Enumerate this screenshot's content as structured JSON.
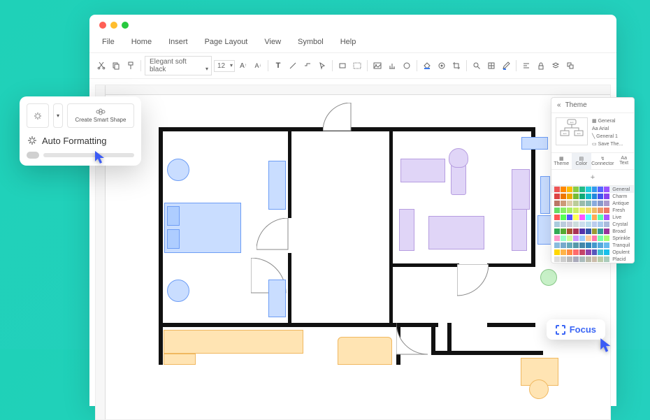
{
  "menu": {
    "file": "File",
    "home": "Home",
    "insert": "Insert",
    "page_layout": "Page Layout",
    "view": "View",
    "symbol": "Symbol",
    "help": "Help"
  },
  "toolbar": {
    "font": "Elegant soft black",
    "size": "12"
  },
  "popover": {
    "create_smart": "Create Smart Shape",
    "auto_fmt": "Auto Formatting"
  },
  "theme": {
    "title": "Theme",
    "opts": {
      "general": "General",
      "arial": "Arial",
      "general1": "General 1",
      "save": "Save The..."
    },
    "tabs": {
      "theme": "Theme",
      "color": "Color",
      "connector": "Connector",
      "text": "Text"
    },
    "plus": "+",
    "palette_names": [
      "General",
      "Charm",
      "Antique",
      "Fresh",
      "Live",
      "Crystal",
      "Broad",
      "Sprinkle",
      "Tranquil",
      "Opulent",
      "Placid"
    ]
  },
  "focus": {
    "label": "Focus"
  },
  "colors": {
    "rows": [
      [
        "#e55",
        "#f80",
        "#fb0",
        "#8c4",
        "#2b8",
        "#2cd",
        "#39e",
        "#56f",
        "#95f",
        "#d5d"
      ],
      [
        "#d44",
        "#e70",
        "#ea0",
        "#7b3",
        "#1a7",
        "#1bc",
        "#28d",
        "#45e",
        "#84e",
        "#c4c"
      ],
      [
        "#b76",
        "#c97",
        "#dca",
        "#bc9",
        "#9ba",
        "#8bb",
        "#8ad",
        "#89c",
        "#a9c",
        "#ba9"
      ],
      [
        "#6d6",
        "#8e6",
        "#ae6",
        "#ce6",
        "#ee6",
        "#ed6",
        "#eb6",
        "#e96",
        "#e76",
        "#e56"
      ],
      [
        "#f55",
        "#5f5",
        "#55f",
        "#ff5",
        "#f5f",
        "#5ff",
        "#fa5",
        "#5fa",
        "#a5f",
        "#af5"
      ],
      [
        "#acd",
        "#bcd",
        "#ccd",
        "#cdd",
        "#cde",
        "#bde",
        "#bce",
        "#ace",
        "#abd",
        "#abd"
      ],
      [
        "#3a5",
        "#5a3",
        "#a53",
        "#a35",
        "#53a",
        "#35a",
        "#993",
        "#399",
        "#939",
        "#693"
      ],
      [
        "#f9c",
        "#9fc",
        "#cf9",
        "#c9f",
        "#9cf",
        "#fc9",
        "#f7a",
        "#7fa",
        "#af7",
        "#a7f"
      ],
      [
        "#8bd",
        "#7ac",
        "#6ab",
        "#59a",
        "#48a",
        "#38b",
        "#49c",
        "#5ad",
        "#6be",
        "#7cf"
      ],
      [
        "#ffd700",
        "#ffb347",
        "#ff8c42",
        "#ff6b6b",
        "#c44569",
        "#8e44ad",
        "#5758bb",
        "#3dc1d3",
        "#17c0eb",
        "#7efff5"
      ],
      [
        "#ddd",
        "#ccc",
        "#bbb",
        "#aab",
        "#abb",
        "#bba",
        "#cba",
        "#bca",
        "#acb",
        "#cab"
      ]
    ]
  }
}
